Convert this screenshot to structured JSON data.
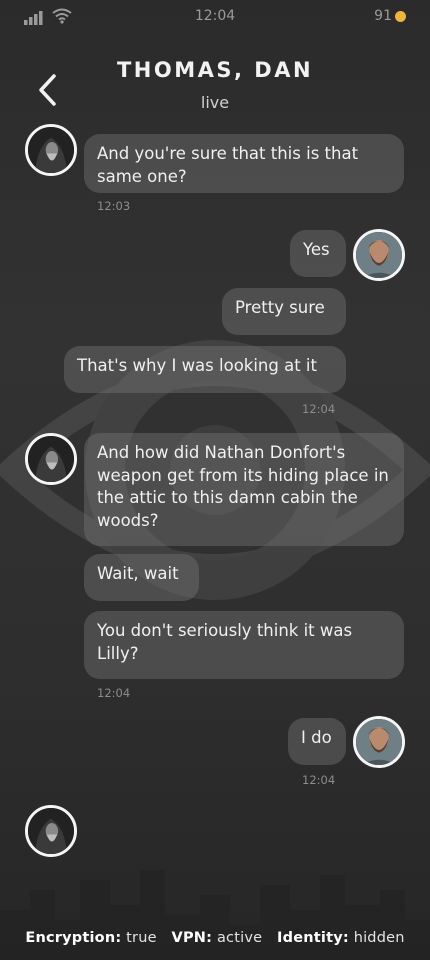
{
  "status_bar": {
    "time": "12:04",
    "battery": "91"
  },
  "header": {
    "title": "THOMAS, DAN",
    "status": "live"
  },
  "messages": [
    {
      "from": "contact",
      "text": "And you're sure that this is that same one?"
    },
    {
      "time": "12:03"
    },
    {
      "from": "me",
      "text": "Yes"
    },
    {
      "from": "me",
      "text": "Pretty sure"
    },
    {
      "from": "me",
      "text": "That's why I was looking at it"
    },
    {
      "time": "12:04"
    },
    {
      "from": "contact",
      "text": "And how did Nathan Donfort's weapon get from its hiding place in the attic to this damn cabin the woods?"
    },
    {
      "from": "contact",
      "text": "Wait, wait"
    },
    {
      "from": "contact",
      "text": "You don't seriously think it was Lilly?"
    },
    {
      "time": "12:04"
    },
    {
      "from": "me",
      "text": "I do"
    },
    {
      "time": "12:04"
    }
  ],
  "footer": {
    "encryption_label": "Encryption:",
    "encryption_value": "true",
    "vpn_label": "VPN:",
    "vpn_value": "active",
    "identity_label": "Identity:",
    "identity_value": "hidden"
  },
  "icons": {
    "back": "chevron-left-icon",
    "signal": "signal-bars-icon",
    "wifi": "wifi-icon",
    "battery": "battery-dot-icon"
  },
  "colors": {
    "battery_dot": "#f0b43a",
    "bubble": "#6b6b6b",
    "background": "#303030"
  }
}
